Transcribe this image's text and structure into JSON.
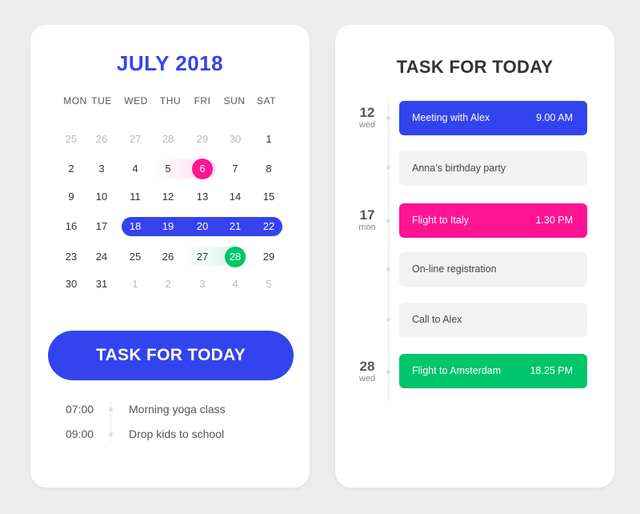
{
  "calendar": {
    "month_title": "JULY 2018",
    "weekdays": [
      "MON",
      "TUE",
      "WED",
      "THU",
      "FRI",
      "SUN",
      "SAT"
    ],
    "weeks": [
      [
        "25",
        "26",
        "27",
        "28",
        "29",
        "30",
        "1"
      ],
      [
        "2",
        "3",
        "4",
        "5",
        "6",
        "7",
        "8"
      ],
      [
        "9",
        "10",
        "11",
        "12",
        "13",
        "14",
        "15"
      ],
      [
        "16",
        "17",
        "18",
        "19",
        "20",
        "21",
        "22"
      ],
      [
        "23",
        "24",
        "25",
        "26",
        "27",
        "28",
        "29"
      ],
      [
        "30",
        "31",
        "1",
        "2",
        "3",
        "4",
        "5"
      ]
    ],
    "selected_pink": "6",
    "selected_green": "28",
    "range_blue": [
      "18",
      "19",
      "20",
      "21",
      "22"
    ]
  },
  "left": {
    "task_button": "TASK FOR TODAY",
    "schedule": [
      {
        "time": "07:00",
        "text": "Morning yoga class"
      },
      {
        "time": "09:00",
        "text": "Drop kids to school"
      }
    ]
  },
  "right": {
    "title": "TASK FOR TODAY",
    "dates": [
      {
        "num": "12",
        "day": "wed"
      },
      {
        "num": "17",
        "day": "mon"
      },
      {
        "num": "28",
        "day": "wed"
      }
    ],
    "events": [
      {
        "name": "Meeting with Alex",
        "time": "9.00 AM",
        "color": "#3344ee"
      },
      {
        "name": "Anna’s birthday party",
        "time": "",
        "color": ""
      },
      {
        "name": "Flight to Italy",
        "time": "1.30 PM",
        "color": "#ff1493"
      },
      {
        "name": "On-line registration",
        "time": "",
        "color": ""
      },
      {
        "name": "Call to Alex",
        "time": "",
        "color": ""
      },
      {
        "name": "Flight to Amsterdam",
        "time": "18.25 PM",
        "color": "#00c56a"
      }
    ]
  },
  "colors": {
    "accent_blue": "#3344ee",
    "accent_pink": "#ff1493",
    "accent_green": "#00c56a"
  }
}
